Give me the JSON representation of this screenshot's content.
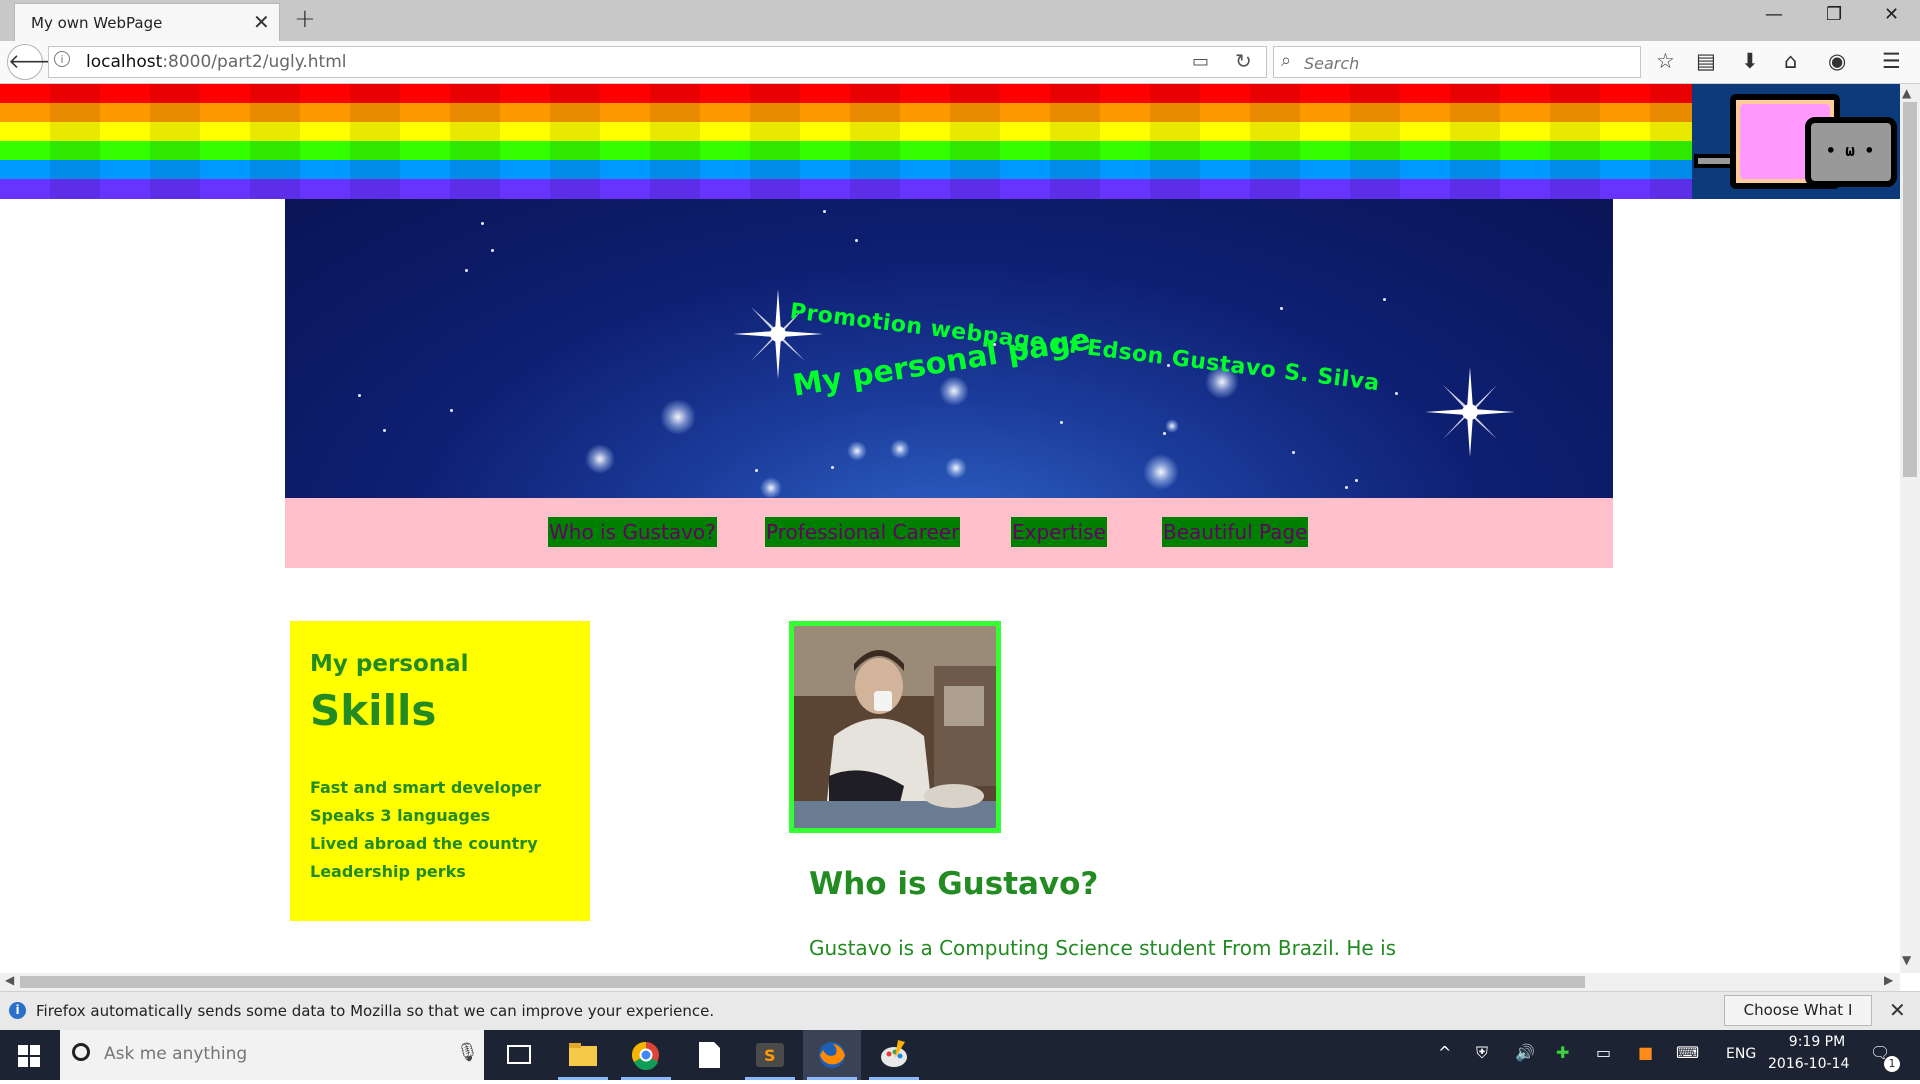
{
  "browser": {
    "tab_title": "My own WebPage",
    "url_host": "localhost",
    "url_rest": ":8000/part2/ugly.html",
    "search_placeholder": "Search"
  },
  "banner": {
    "promo": "Promotion webpage of Edson Gustavo S. Silva",
    "personal": "My personal page"
  },
  "menu": {
    "items": [
      {
        "label": "Who is Gustavo?"
      },
      {
        "label": "Professional Career"
      },
      {
        "label": "Expertise"
      },
      {
        "label": "Beautiful Page"
      }
    ]
  },
  "skills": {
    "small": "My personal",
    "big": "Skills",
    "items": [
      "Fast and smart developer",
      "Speaks 3 languages",
      "Lived abroad the country",
      "Leadership perks"
    ]
  },
  "main": {
    "heading": "Who is Gustavo?",
    "text": "Gustavo is a Computing Science student From Brazil. He is"
  },
  "notification": {
    "text": "Firefox automatically sends some data to Mozilla so that we can improve your experience.",
    "button": "Choose What I Share"
  },
  "taskbar": {
    "search_placeholder": "Ask me anything",
    "lang": "ENG",
    "time": "9:19 PM",
    "date": "2016-10-14",
    "notif_count": "1"
  },
  "colors": {
    "banner_text": "#00ff2a",
    "menu_bg": "#ffc0cb",
    "menu_item_bg": "#008000",
    "menu_item_text": "#660066",
    "skills_bg": "#ffff00",
    "text_green": "#228b22",
    "photo_border": "#33ff33"
  }
}
